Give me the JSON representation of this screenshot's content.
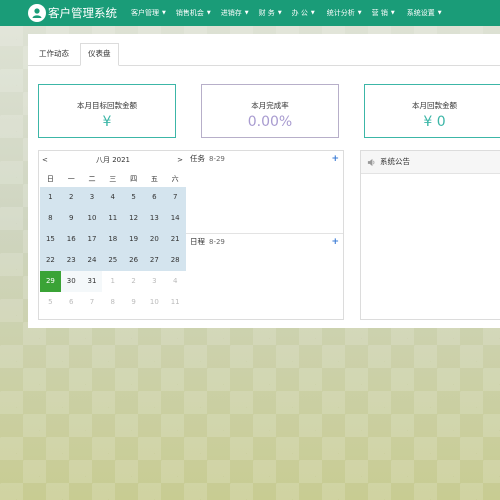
{
  "app": {
    "title": "客户管理系统"
  },
  "menu": [
    {
      "label": "客户管理",
      "caret": "▼"
    },
    {
      "label": "销售机会",
      "caret": "▼"
    },
    {
      "label": "进销存",
      "caret": "▼"
    },
    {
      "label": "财 务",
      "caret": "▼"
    },
    {
      "label": "办 公",
      "caret": "▼"
    },
    {
      "label": "统计分析",
      "caret": "▼"
    },
    {
      "label": "营 销",
      "caret": "▼"
    },
    {
      "label": "系统设置",
      "caret": "▼"
    }
  ],
  "tabs": [
    {
      "label": "工作动态",
      "active": false
    },
    {
      "label": "仪表盘",
      "active": true
    }
  ],
  "cards": [
    {
      "label": "本月目标回款金额",
      "value": "¥"
    },
    {
      "label": "本月完成率",
      "value": "0.00%"
    },
    {
      "label": "本月回款金额",
      "value": "¥ 0"
    }
  ],
  "calendar": {
    "prev": "<",
    "next": ">",
    "title": "八月 2021",
    "weekdays": [
      "日",
      "一",
      "二",
      "三",
      "四",
      "五",
      "六"
    ],
    "weeks": [
      [
        "1",
        "2",
        "3",
        "4",
        "5",
        "6",
        "7"
      ],
      [
        "8",
        "9",
        "10",
        "11",
        "12",
        "13",
        "14"
      ],
      [
        "15",
        "16",
        "17",
        "18",
        "19",
        "20",
        "21"
      ],
      [
        "22",
        "23",
        "24",
        "25",
        "26",
        "27",
        "28"
      ],
      [
        "29",
        "30",
        "31",
        "1",
        "2",
        "3",
        "4"
      ],
      [
        "5",
        "6",
        "7",
        "8",
        "9",
        "10",
        "11"
      ]
    ],
    "today": "29"
  },
  "tasks": {
    "label": "任务",
    "date": "8-29",
    "add": "+"
  },
  "schedule": {
    "label": "日程",
    "date": "8-29",
    "add": "+"
  },
  "notice": {
    "title": "系统公告"
  },
  "colors": {
    "topbar": "#1a9c78",
    "accent": "#3cb6a7",
    "rate": "#a89bd0",
    "today": "#3aa336",
    "calendar_cell": "#d4e4ee"
  }
}
